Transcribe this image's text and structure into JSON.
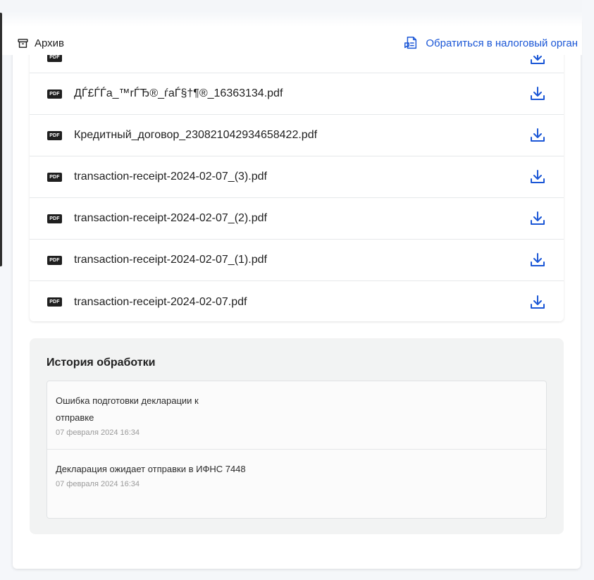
{
  "header": {
    "archive_label": "Архив",
    "contact_label": "Обратиться в налоговый орган"
  },
  "files": [
    {
      "badge": "PDF",
      "name": "ДЃ£ЃЃa_™rЃЂ®_ѓaЃ§†¶®_16363134.pdf"
    },
    {
      "badge": "PDF",
      "name": "Кредитный_договор_230821042934658422.pdf"
    },
    {
      "badge": "PDF",
      "name": "transaction-receipt-2024-02-07_(3).pdf"
    },
    {
      "badge": "PDF",
      "name": "transaction-receipt-2024-02-07_(2).pdf"
    },
    {
      "badge": "PDF",
      "name": "transaction-receipt-2024-02-07_(1).pdf"
    },
    {
      "badge": "PDF",
      "name": "transaction-receipt-2024-02-07.pdf"
    }
  ],
  "history": {
    "title": "История обработки",
    "items": [
      {
        "text": "Ошибка подготовки декларации к отправке",
        "date": "07 февраля 2024 16:34"
      },
      {
        "text": "Декларация ожидает отправки в ИФНС 7448",
        "date": "07 февраля 2024 16:34"
      }
    ]
  },
  "colors": {
    "accent": "#1a56d6",
    "badge": "#1f1f1f"
  }
}
